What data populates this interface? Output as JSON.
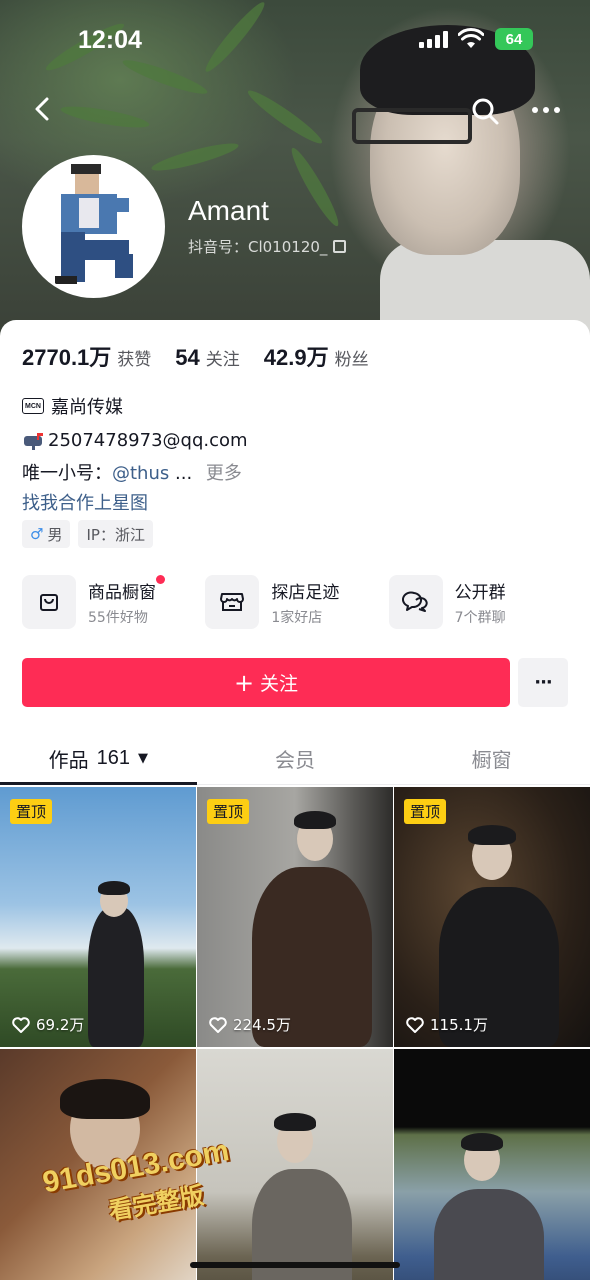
{
  "status_bar": {
    "time": "12:04",
    "battery": "64"
  },
  "header": {
    "back_icon": "chevron-left-icon",
    "search_icon": "search-icon",
    "more_icon": "more-horizontal-icon"
  },
  "profile": {
    "name": "Amant",
    "douyin_id": "抖音号：Cl010120_",
    "stats": [
      {
        "num": "2770.1万",
        "label": "获赞"
      },
      {
        "num": "54",
        "label": "关注"
      },
      {
        "num": "42.9万",
        "label": "粉丝"
      }
    ],
    "mcn_badge": "MCN",
    "mcn_name": "嘉尚传媒",
    "bio_email": "2507478973@qq.com",
    "bio_alt_prefix": "唯一小号：",
    "bio_alt_link": "@thus",
    "bio_alt_ellipsis": "...",
    "bio_more": "更多",
    "xingtu_link": "找我合作上星图",
    "tags": {
      "gender_symbol": "♂",
      "gender": "男",
      "ip": "IP：浙江"
    }
  },
  "shortcuts": [
    {
      "title": "商品橱窗",
      "sub": "55件好物",
      "icon": "shopping-bag-icon",
      "dot": true
    },
    {
      "title": "探店足迹",
      "sub": "1家好店",
      "icon": "store-icon",
      "dot": false
    },
    {
      "title": "公开群",
      "sub": "7个群聊",
      "icon": "chat-bubbles-icon",
      "dot": false
    }
  ],
  "actions": {
    "follow_label": "关注",
    "follow_plus": "+",
    "more_label": "···"
  },
  "tabs": [
    {
      "label": "作品",
      "count": "161",
      "caret": "▼"
    },
    {
      "label": "会员"
    },
    {
      "label": "橱窗"
    }
  ],
  "videos": [
    {
      "pinned": true,
      "pin_label": "置顶",
      "likes": "69.2万"
    },
    {
      "pinned": true,
      "pin_label": "置顶",
      "likes": "224.5万"
    },
    {
      "pinned": true,
      "pin_label": "置顶",
      "likes": "115.1万"
    },
    {
      "pinned": false,
      "likes": ""
    },
    {
      "pinned": false,
      "likes": ""
    },
    {
      "pinned": false,
      "likes": ""
    }
  ],
  "watermark": {
    "line1": "91ds013.com",
    "line2": "看完整版"
  },
  "colors": {
    "accent": "#fe2c55",
    "pin": "#fdce13",
    "link": "#3d5f8a",
    "battery": "#34c759"
  }
}
